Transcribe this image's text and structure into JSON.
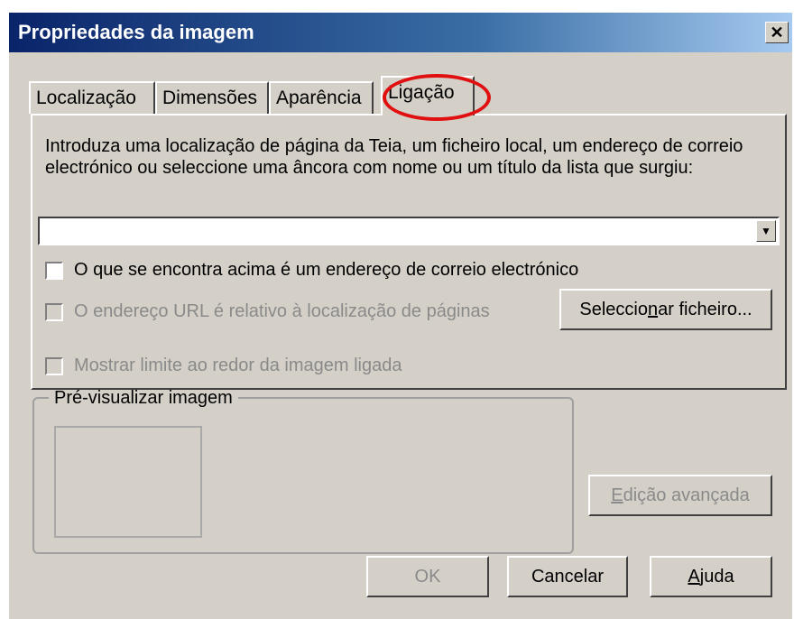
{
  "window": {
    "title": "Propriedades da imagem",
    "close_icon": "close-icon"
  },
  "tabs": [
    {
      "label": "Localização"
    },
    {
      "label": "Dimensões"
    },
    {
      "label": "Aparência"
    },
    {
      "label": "Ligação",
      "active": true
    }
  ],
  "link_panel": {
    "intro_text": "Introduza uma localização de página da Teia, um ficheiro local, um endereço de correio electrónico ou seleccione uma âncora com nome ou um título da lista que surgiu:",
    "url_value": "",
    "checkbox_email": {
      "label": "O que se encontra acima é um endereço de correio electrónico",
      "checked": false
    },
    "checkbox_relative": {
      "label": "O endereço URL é relativo à localização de páginas",
      "checked": false,
      "disabled": true
    },
    "checkbox_border": {
      "label": "Mostrar limite ao redor da imagem ligada",
      "checked": false,
      "disabled": true
    },
    "choose_file_button": {
      "before": "Seleccio",
      "underlined": "n",
      "after": "ar ficheiro..."
    }
  },
  "preview": {
    "group_label": "Pré-visualizar imagem"
  },
  "buttons": {
    "advanced_edit": {
      "underlined": "E",
      "after": "dição avançada"
    },
    "ok": "OK",
    "cancel": "Cancelar",
    "help": {
      "underlined": "A",
      "after": "juda"
    }
  },
  "colors": {
    "dialog_background": "#d4d0c8",
    "title_gradient_start": "#0a246a",
    "title_gradient_end": "#a6caf0",
    "highlight_ring": "#e01010",
    "disabled_text": "#8a8a8a"
  }
}
